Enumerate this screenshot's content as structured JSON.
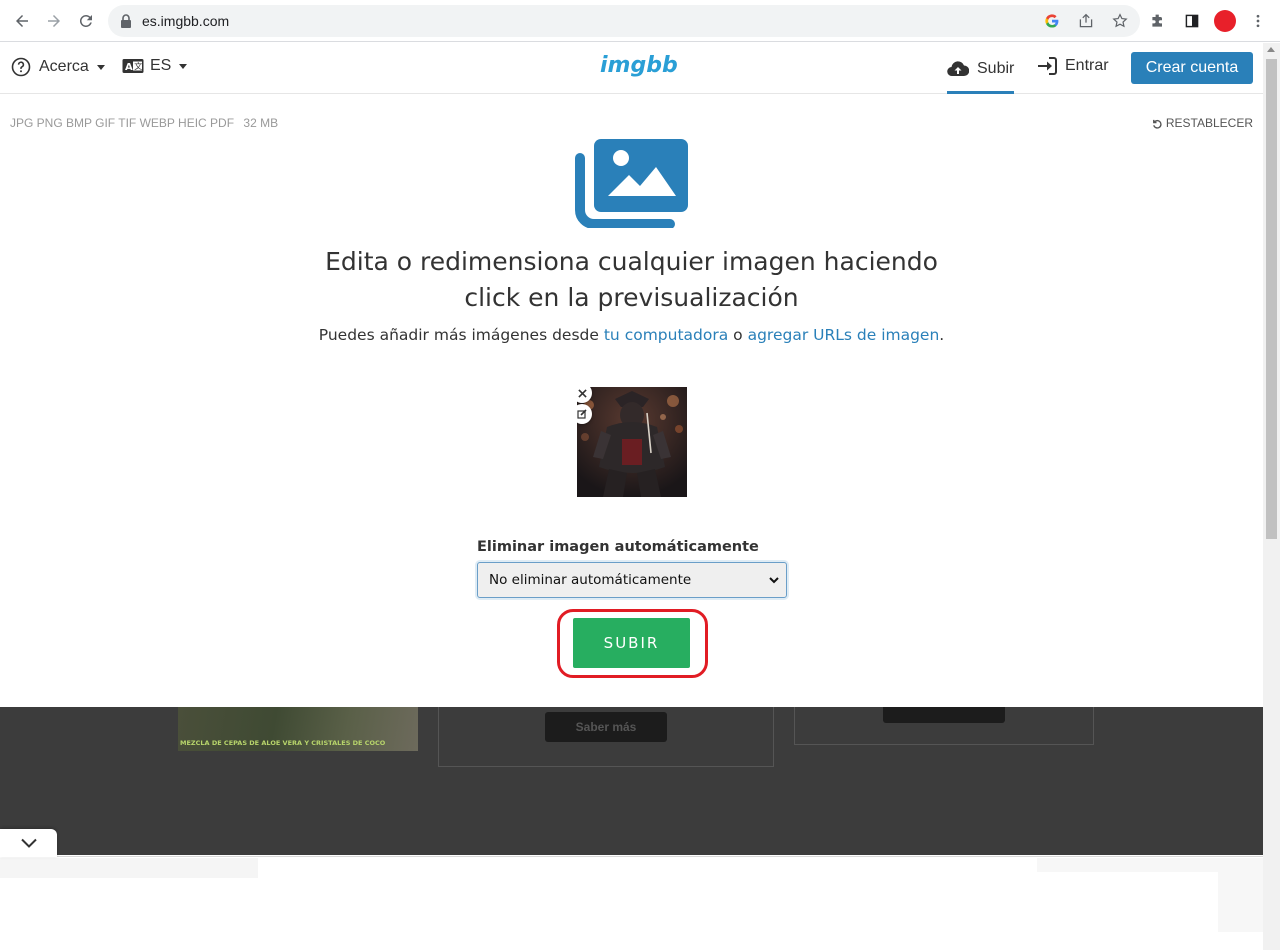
{
  "browser": {
    "url": "es.imgbb.com"
  },
  "header": {
    "about_label": "Acerca",
    "lang_label": "ES",
    "logo_text": "imgbb",
    "upload_tab_label": "Subir",
    "login_label": "Entrar",
    "signup_label": "Crear cuenta"
  },
  "upload": {
    "formats": "JPG PNG BMP GIF TIF WEBP HEIC PDF",
    "max_size": "32 MB",
    "reset_label": "RESTABLECER",
    "headline_line1": "Edita o redimensiona cualquier imagen haciendo",
    "headline_line2": "click en la previsualización",
    "sub_prefix": "Puedes añadir más imágenes desde",
    "link_computer": "tu computadora",
    "sub_or": "o",
    "link_urls": "agregar URLs de imagen",
    "sub_suffix": ".",
    "autodelete_label": "Eliminar imagen automáticamente",
    "autodelete_value": "No eliminar automáticamente",
    "submit_label": "SUBIR"
  },
  "background_ads": {
    "caption": "MEZCLA DE CEPAS DE ALOE VERA Y CRISTALES DE COCO",
    "button_label": "Saber más"
  },
  "colors": {
    "accent": "#2a80b9",
    "logo": "#2a9fd6",
    "submit": "#27ae60",
    "highlight": "#e11c24"
  }
}
